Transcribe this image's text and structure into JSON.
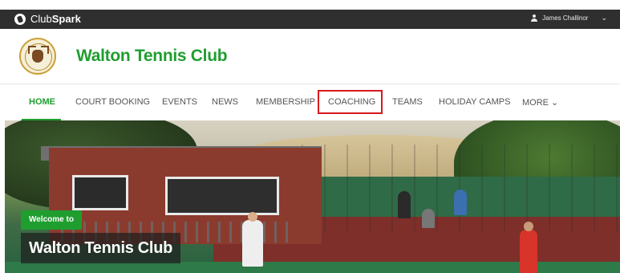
{
  "topbar": {
    "brand_prefix": "Club",
    "brand_suffix": "Spark",
    "user_name": "James Challinor",
    "chevron": "⌄"
  },
  "header": {
    "club_name": "Walton Tennis Club"
  },
  "nav": {
    "items": [
      {
        "label": "HOME"
      },
      {
        "label": "COURT BOOKING"
      },
      {
        "label": "EVENTS"
      },
      {
        "label": "NEWS"
      },
      {
        "label": "MEMBERSHIP"
      },
      {
        "label": "COACHING"
      },
      {
        "label": "TEAMS"
      },
      {
        "label": "HOLIDAY CAMPS"
      },
      {
        "label": "MORE ⌄"
      }
    ],
    "active_index": 0,
    "highlighted_index": 5
  },
  "hero": {
    "tag": "Welcome to",
    "title": "Walton Tennis Club"
  },
  "colors": {
    "accent_green": "#1f9e2f",
    "highlight_red": "#d7191c",
    "topbar": "#2f2f2f"
  }
}
